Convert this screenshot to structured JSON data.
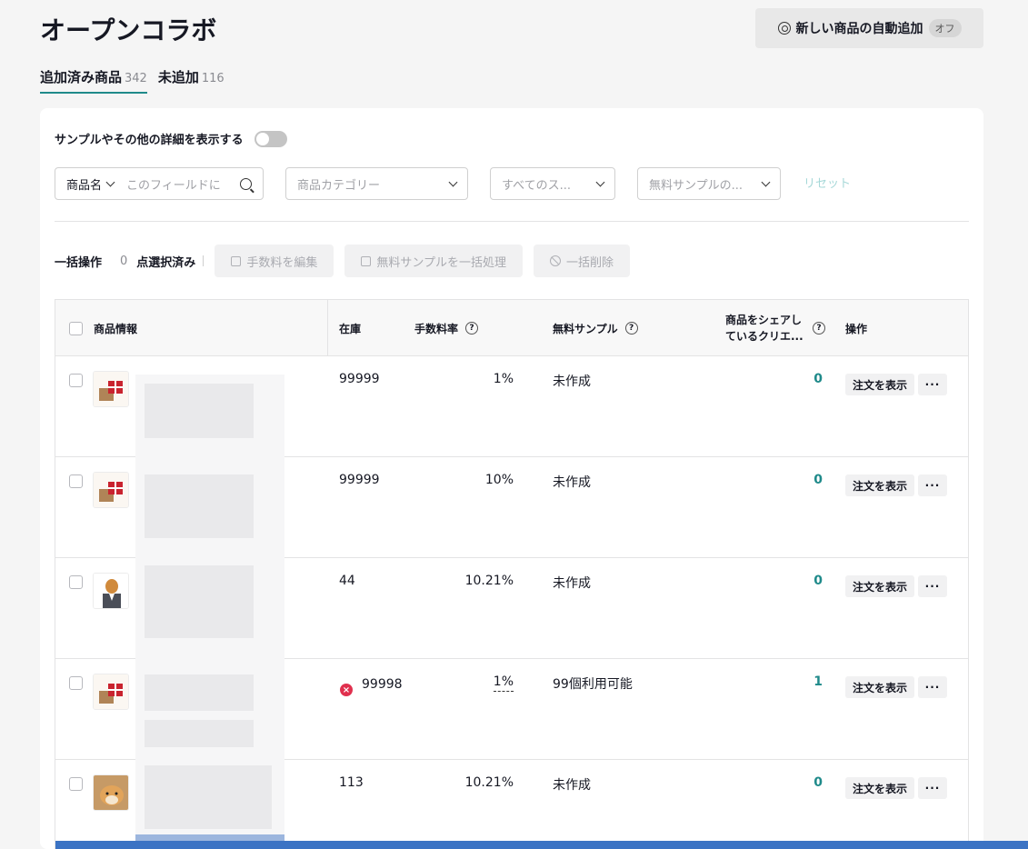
{
  "header": {
    "title": "オープンコラボ",
    "auto_add_label": "新しい商品の自動追加",
    "auto_add_status": "オフ"
  },
  "tabs": [
    {
      "label": "追加済み商品",
      "count": "342",
      "active": true
    },
    {
      "label": "未追加",
      "count": "116",
      "active": false
    }
  ],
  "detail_toggle_label": "サンプルやその他の詳細を表示する",
  "filters": {
    "name_select": "商品名",
    "search_placeholder": "このフィールドに",
    "category_placeholder": "商品カテゴリー",
    "status_placeholder": "すべてのス...",
    "sample_placeholder": "無料サンプルの...",
    "reset_label": "リセット"
  },
  "bulk": {
    "label": "一括操作",
    "selected_count": "0",
    "selected_label": "点選択済み",
    "edit_commission": "手数料を編集",
    "bulk_sample": "無料サンプルを一括処理",
    "bulk_delete": "一括削除"
  },
  "table": {
    "headers": {
      "product": "商品情報",
      "stock": "在庫",
      "rate": "手数料率",
      "sample": "無料サンプル",
      "share": "商品をシェアしているクリエ...",
      "actions": "操作"
    },
    "rows": [
      {
        "stock": "99999",
        "rate": "1%",
        "sample": "未作成",
        "creators": "0",
        "order": "注文を表示",
        "thumb": "gift"
      },
      {
        "stock": "99999",
        "rate": "10%",
        "sample": "未作成",
        "creators": "0",
        "order": "注文を表示",
        "thumb": "gift"
      },
      {
        "stock": "44",
        "rate": "10.21%",
        "sample": "未作成",
        "creators": "0",
        "order": "注文を表示",
        "thumb": "dog-suit"
      },
      {
        "stock": "99998",
        "rate": "1%",
        "sample": "99個利用可能",
        "creators": "1",
        "order": "注文を表示",
        "thumb": "gift",
        "stock_error": true
      },
      {
        "stock": "113",
        "rate": "10.21%",
        "sample": "未作成",
        "creators": "0",
        "order": "注文を表示",
        "thumb": "shiba"
      }
    ]
  },
  "colors": {
    "accent": "#1f8a8a",
    "error": "#e0304e",
    "bottom_bar": "#3b73c4"
  }
}
